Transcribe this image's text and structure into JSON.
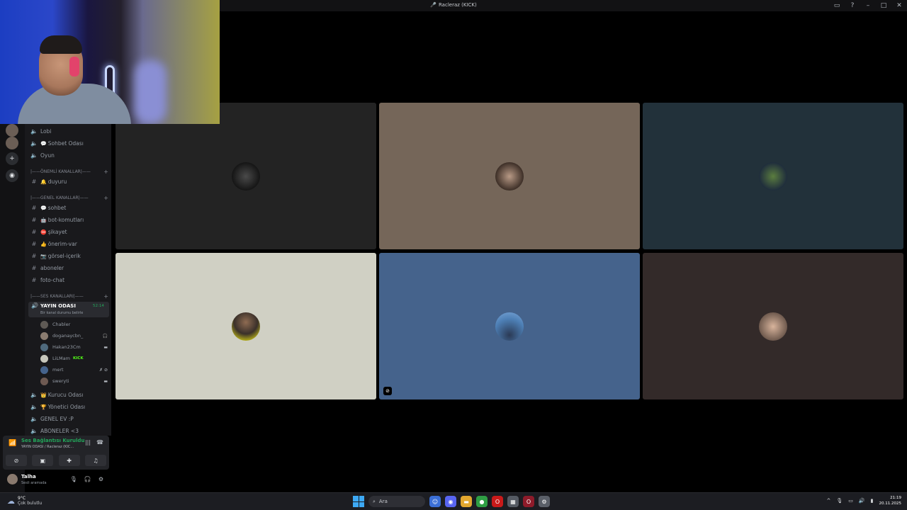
{
  "window": {
    "title": "Racleraz (KICK)"
  },
  "sidebar": {
    "channels_top": [
      {
        "name": "Lobi",
        "type": "voice"
      },
      {
        "name": "Sohbet Odası",
        "type": "voice",
        "emoji": "💬"
      },
      {
        "name": "Oyun",
        "type": "voice"
      }
    ],
    "category_important": "|——ÖNEMLİ KANALLAR|——",
    "channels_important": [
      {
        "name": "duyuru",
        "emoji": "🔔"
      }
    ],
    "category_general": "|——GENEL KANALLAR|——",
    "channels_general": [
      {
        "name": "sohbet",
        "emoji": "💬"
      },
      {
        "name": "bot-komutları",
        "emoji": "🤖"
      },
      {
        "name": "şikayet",
        "emoji": "⛔"
      },
      {
        "name": "önerim-var",
        "emoji": "👍"
      },
      {
        "name": "görsel-içerik",
        "emoji": "📷"
      },
      {
        "name": "aboneler",
        "emoji": ""
      },
      {
        "name": "foto-chat",
        "emoji": ""
      }
    ],
    "category_voice": "|——SES KANALLARI|——",
    "active_voice": {
      "name": "YAYIN ODASI",
      "duration": "52:14",
      "status_hint": "Bir kanal durumu belirle"
    },
    "voice_users": [
      {
        "name": "Chabler",
        "badge": ""
      },
      {
        "name": "doganaycbn_",
        "badge": ""
      },
      {
        "name": "Hakan23Cm",
        "badge": ""
      },
      {
        "name": "LiLMam",
        "badge": "KICK"
      },
      {
        "name": "mert",
        "badge": ""
      },
      {
        "name": "sweryti",
        "badge": ""
      }
    ],
    "channels_bottom": [
      {
        "name": "Kurucu Odası",
        "emoji": "👑"
      },
      {
        "name": "Yönetici Odası",
        "emoji": "🏆"
      },
      {
        "name": "GENEL EV :P",
        "emoji": ""
      },
      {
        "name": "ABONELER <3",
        "emoji": ""
      }
    ]
  },
  "voice_panel": {
    "status": "Ses Bağlantısı Kuruldu",
    "channel": "YAYIN ODASI / Racleraz (KIC..."
  },
  "user_panel": {
    "name": "Talha",
    "status": "Sesli aramada"
  },
  "taskbar": {
    "temperature": "9°C",
    "weather": "Çok bulutlu",
    "search_placeholder": "Ara",
    "time": "21:19",
    "date": "20.11.2025"
  },
  "colors": {
    "accent_green": "#23a55a",
    "tile_bg": [
      "#232323",
      "#756659",
      "#22313a",
      "#d0d0c4",
      "#45638c",
      "#332a29"
    ]
  }
}
